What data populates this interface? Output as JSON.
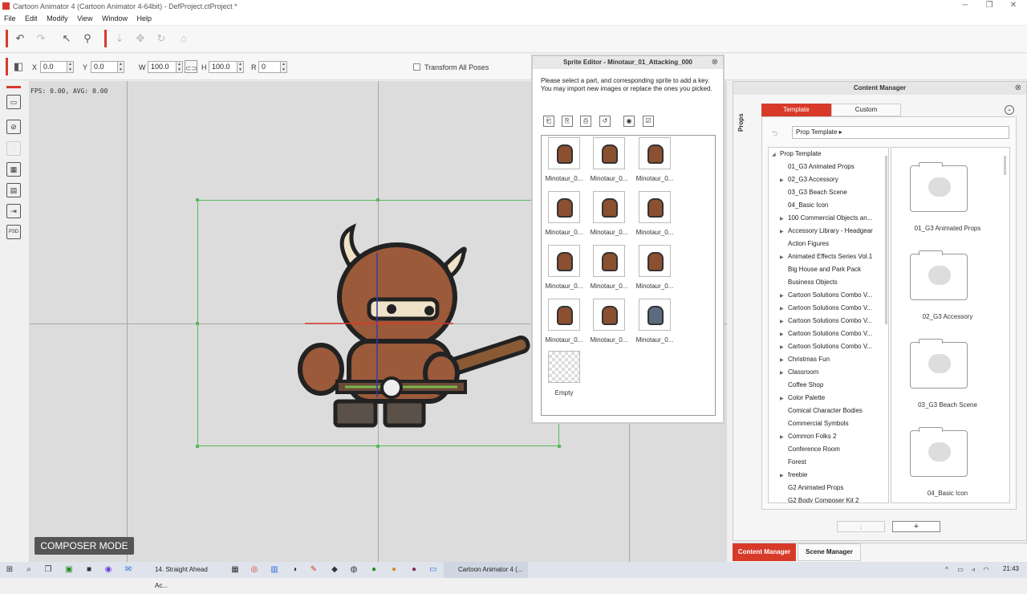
{
  "window": {
    "title": "Cartoon Animator 4  (Cartoon Animator 4-64bit) - DefProject.ctProject *",
    "minimize": "─",
    "maximize": "❐",
    "close": "✕"
  },
  "menu": [
    "File",
    "Edit",
    "Modify",
    "View",
    "Window",
    "Help"
  ],
  "toolbar": {
    "icons": [
      "undo-icon",
      "redo-icon",
      "select-icon",
      "bone-icon",
      "move-icon",
      "transform-icon",
      "rotate-icon",
      "home-icon"
    ]
  },
  "transform": {
    "x_label": "X",
    "x_value": "0.0",
    "y_label": "Y",
    "y_value": "0.0",
    "w_label": "W",
    "w_value": "100.0",
    "h_label": "H",
    "h_value": "100.0",
    "r_label": "R",
    "r_value": "0",
    "transform_all_label": "Transform All Poses"
  },
  "canvas": {
    "fps": "FPS: 0.00, AVG: 0.00",
    "mode": "COMPOSER MODE"
  },
  "sprite_editor": {
    "title": "Sprite Editor - Minotaur_01_Attacking_000",
    "instructions": "Please select a part, and corresponding sprite to add a key.\nYou may import new images or replace the ones you picked.",
    "sprites": [
      "Minotaur_0...",
      "Minotaur_0...",
      "Minotaur_0...",
      "Minotaur_0...",
      "Minotaur_0...",
      "Minotaur_0...",
      "Minotaur_0...",
      "Minotaur_0...",
      "Minotaur_0...",
      "Minotaur_0...",
      "Minotaur_0...",
      "Minotaur_0..."
    ],
    "empty_label": "Empty"
  },
  "content_manager": {
    "title": "Content Manager",
    "side_label": "Props",
    "tab_template": "Template",
    "tab_custom": "Custom",
    "path": "Prop Template ▸",
    "tree_root": "Prop Template",
    "tree": [
      {
        "label": "01_G3 Animated Props",
        "arrow": false
      },
      {
        "label": "02_G3 Accessory",
        "arrow": true
      },
      {
        "label": "03_G3 Beach Scene",
        "arrow": false
      },
      {
        "label": "04_Basic Icon",
        "arrow": false
      },
      {
        "label": "100 Commercial Objects an...",
        "arrow": true
      },
      {
        "label": "Accessory Library - Headgear",
        "arrow": true
      },
      {
        "label": "Action Figures",
        "arrow": false
      },
      {
        "label": "Animated Effects Series Vol.1",
        "arrow": true
      },
      {
        "label": "Big House and Park Pack",
        "arrow": false
      },
      {
        "label": "Business Objects",
        "arrow": false
      },
      {
        "label": "Cartoon Solutions Combo V...",
        "arrow": true
      },
      {
        "label": "Cartoon Solutions Combo V...",
        "arrow": true
      },
      {
        "label": "Cartoon Solutions Combo V...",
        "arrow": true
      },
      {
        "label": "Cartoon Solutions Combo V...",
        "arrow": true
      },
      {
        "label": "Cartoon Solutions Combo V...",
        "arrow": true
      },
      {
        "label": "Christmas Fun",
        "arrow": true
      },
      {
        "label": "Classroom",
        "arrow": true
      },
      {
        "label": "Coffee Shop",
        "arrow": false
      },
      {
        "label": "Color Palette",
        "arrow": true
      },
      {
        "label": "Comical Character Bodies",
        "arrow": false
      },
      {
        "label": "Commercial Symbols",
        "arrow": false
      },
      {
        "label": "Common Folks 2",
        "arrow": true
      },
      {
        "label": "Conference Room",
        "arrow": false
      },
      {
        "label": "Forest",
        "arrow": false
      },
      {
        "label": "freebie",
        "arrow": true
      },
      {
        "label": "G2 Animated Props",
        "arrow": false
      },
      {
        "label": "G2 Body Composer Kit 2",
        "arrow": false
      }
    ],
    "thumbnails": [
      "01_G3 Animated Props",
      "02_G3 Accessory",
      "03_G3 Beach Scene",
      "04_Basic Icon"
    ],
    "download_btn": "↓",
    "add_btn": "+",
    "footer_tab1": "Content Manager",
    "footer_tab2": "Scene Manager"
  },
  "taskbar": {
    "item1": "14. Straight Ahead Ac...",
    "item2": "Cartoon Animator 4  (...",
    "clock": "21:43"
  },
  "colors": {
    "accent": "#d83a2a",
    "selection": "#5cb85c"
  }
}
